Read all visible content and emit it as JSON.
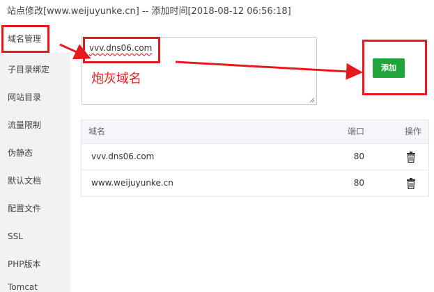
{
  "window": {
    "title": "站点修改[www.weijuyunke.cn] -- 添加时间[2018-08-12 06:56:18]"
  },
  "sidebar": {
    "items": [
      {
        "label": "域名管理"
      },
      {
        "label": "子目录绑定"
      },
      {
        "label": "网站目录"
      },
      {
        "label": "流量限制"
      },
      {
        "label": "伪静态"
      },
      {
        "label": "默认文档"
      },
      {
        "label": "配置文件"
      },
      {
        "label": "SSL"
      },
      {
        "label": "PHP版本"
      },
      {
        "label": "Tomcat"
      }
    ]
  },
  "form": {
    "domain_input_value": "vvv.dns06.com",
    "add_label": "添加"
  },
  "annotation": {
    "text": "炮灰域名",
    "color": "#e8191e"
  },
  "table": {
    "headers": [
      "域名",
      "端口",
      "操作"
    ],
    "rows": [
      {
        "domain": "vvv.dns06.com",
        "port": "80"
      },
      {
        "domain": "www.weijuyunke.cn",
        "port": "80"
      }
    ]
  },
  "colors": {
    "accent": "#20a53a",
    "annotation_red": "#e8191e"
  }
}
